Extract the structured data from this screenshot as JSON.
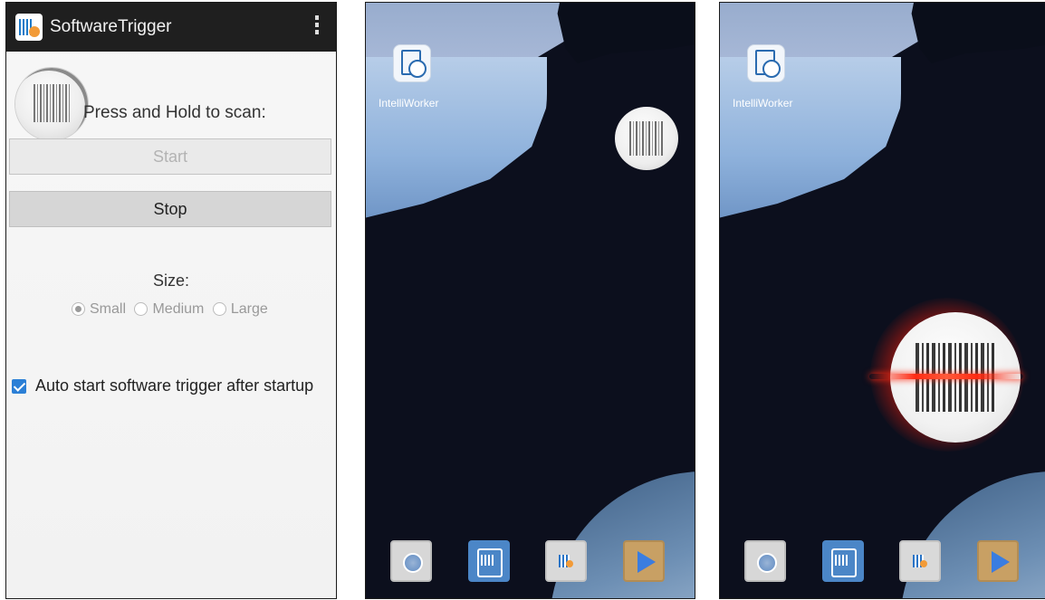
{
  "app": {
    "title": "SoftwareTrigger",
    "scan_prompt": "Press and Hold to scan:",
    "start_label": "Start",
    "stop_label": "Stop",
    "size_label": "Size:",
    "size_options": [
      "Small",
      "Medium",
      "Large"
    ],
    "size_selected": "Small",
    "auto_start_label": "Auto start software trigger after startup",
    "auto_start_checked": true,
    "icons": {
      "app": "software-trigger-app-icon",
      "menu": "overflow-menu-icon",
      "scan": "barcode-scan-icon"
    }
  },
  "home_screens": [
    {
      "shortcut_label": "IntelliWorker",
      "floating_trigger": "small barcode trigger button",
      "dock": [
        "keyboard-app-icon",
        "scan-app-icon",
        "software-trigger-app-icon",
        "play-store-icon"
      ]
    },
    {
      "shortcut_label": "IntelliWorker",
      "floating_trigger": "large barcode trigger button scanning",
      "dock": [
        "keyboard-app-icon",
        "scan-app-icon",
        "software-trigger-app-icon",
        "play-store-icon"
      ]
    }
  ],
  "colors": {
    "appbar": "#1f1f1f",
    "checkbox": "#2b7fd6",
    "laser": "#ff2a12",
    "wallpaper_dark": "#0c0f1d"
  }
}
